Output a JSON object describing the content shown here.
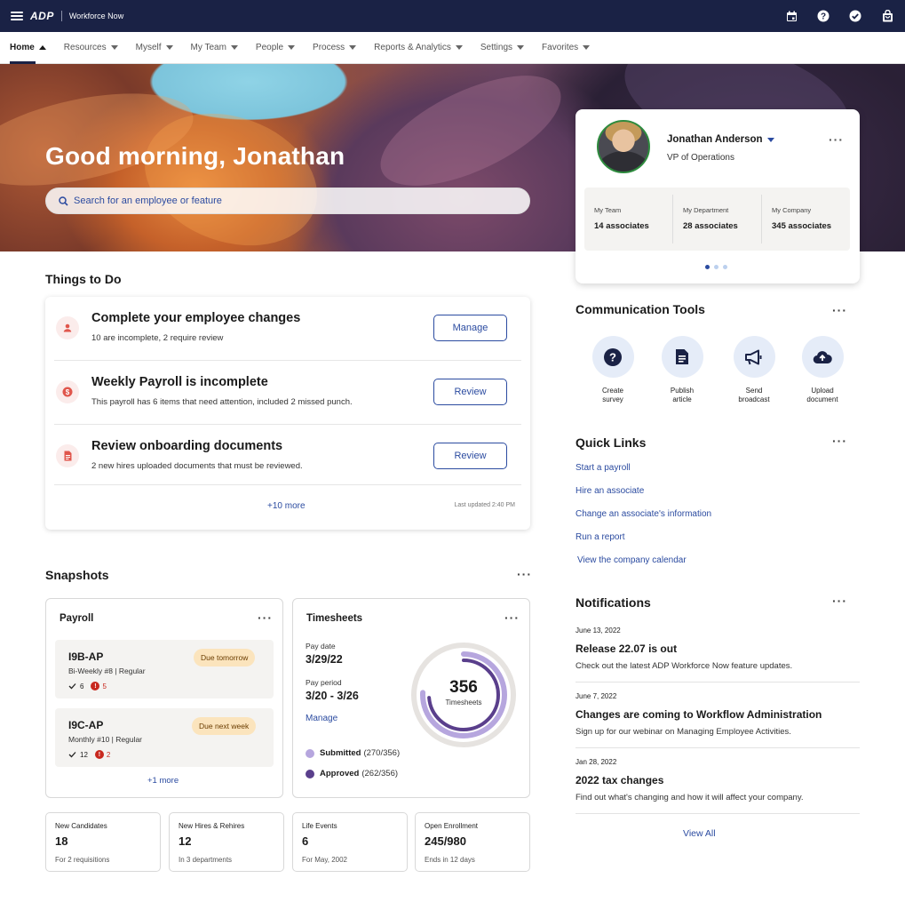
{
  "topbar": {
    "logo": "ADP",
    "app_title": "Workforce Now"
  },
  "nav": {
    "items": [
      {
        "label": "Home"
      },
      {
        "label": "Resources"
      },
      {
        "label": "Myself"
      },
      {
        "label": "My Team"
      },
      {
        "label": "People"
      },
      {
        "label": "Process"
      },
      {
        "label": "Reports & Analytics"
      },
      {
        "label": "Settings"
      },
      {
        "label": "Favorites"
      }
    ],
    "active": "Home"
  },
  "hero": {
    "greeting": "Good morning,  Jonathan",
    "search_placeholder": "Search for an employee or feature"
  },
  "profile": {
    "name": "Jonathan Anderson",
    "role": "VP of Operations",
    "stats": [
      {
        "label": "My Team",
        "value": "14 associates"
      },
      {
        "label": "My Department",
        "value": "28 associates"
      },
      {
        "label": "My Company",
        "value": "345 associates"
      }
    ],
    "carousel_page": 1,
    "carousel_pages": 3
  },
  "things_to_do": {
    "title": "Things to Do",
    "items": [
      {
        "icon": "person-icon",
        "title": "Complete your employee changes",
        "subtitle": "10 are incomplete, 2 require review",
        "button": "Manage"
      },
      {
        "icon": "dollar-icon",
        "title": "Weekly Payroll is incomplete",
        "subtitle": "This payroll has 6 items that need attention, included 2 missed punch.",
        "button": "Review"
      },
      {
        "icon": "document-icon",
        "title": "Review onboarding documents",
        "subtitle": "2 new hires uploaded documents that must be reviewed.",
        "button": "Review"
      }
    ],
    "more_link": "+10 more",
    "last_updated": "Last updated 2:40 PM"
  },
  "snapshots": {
    "title": "Snapshots",
    "payroll": {
      "title": "Payroll",
      "items": [
        {
          "code": "I9B-AP",
          "sub": "Bi-Weekly #8 |  Regular",
          "badge": "Due tomorrow",
          "ok": "6",
          "errors": "5"
        },
        {
          "code": "I9C-AP",
          "sub": "Monthly #10 |  Regular",
          "badge": "Due next week",
          "ok": "12",
          "errors": "2"
        }
      ],
      "more_link": "+1 more"
    },
    "timesheets": {
      "title": "Timesheets",
      "pay_date_label": "Pay date",
      "pay_date": "3/29/22",
      "pay_period_label": "Pay period",
      "pay_period": "3/20 - 3/26",
      "manage_link": "Manage",
      "total": "356",
      "total_label": "Timesheets",
      "submitted_label": "Submitted",
      "submitted_value": "(270/356)",
      "approved_label": "Approved",
      "approved_value": "(262/356)",
      "submitted_fraction": 0.758,
      "approved_fraction": 0.736,
      "colors": {
        "submitted": "#b6a6de",
        "approved": "#5a3f8c",
        "track": "#e6e3e0"
      }
    },
    "tiles": [
      {
        "label": "New Candidates",
        "value": "18",
        "sub": "For 2 requisitions"
      },
      {
        "label": "New Hires & Rehires",
        "value": "12",
        "sub": "In 3 departments"
      },
      {
        "label": "Life Events",
        "value": "6",
        "sub": "For May, 2002"
      },
      {
        "label": "Open Enrollment",
        "value": "245/980",
        "sub": "Ends in 12 days"
      }
    ]
  },
  "communication_tools": {
    "title": "Communication Tools",
    "tools": [
      {
        "icon": "question-icon",
        "label_line1": "Create",
        "label_line2": "survey"
      },
      {
        "icon": "article-icon",
        "label_line1": "Publish",
        "label_line2": "article"
      },
      {
        "icon": "megaphone-icon",
        "label_line1": "Send",
        "label_line2": "broadcast"
      },
      {
        "icon": "cloud-upload-icon",
        "label_line1": "Upload",
        "label_line2": "document"
      }
    ]
  },
  "quick_links": {
    "title": "Quick Links",
    "links": [
      "Start a payroll",
      "Hire an associate",
      "Change an associate's information",
      "Run a report",
      "View the company calendar"
    ]
  },
  "notifications": {
    "title": "Notifications",
    "items": [
      {
        "date": "June 13, 2022",
        "title": "Release 22.07 is out",
        "text": "Check out the latest ADP Workforce Now feature updates."
      },
      {
        "date": "June 7, 2022",
        "title": "Changes are coming to Workflow Administration",
        "text": "Sign up for our webinar on Managing Employee Activities."
      },
      {
        "date": "Jan 28, 2022",
        "title": "2022 tax changes",
        "text": "Find out what's changing and how it will affect your company."
      }
    ],
    "view_all": "View All"
  },
  "colors": {
    "navy": "#1a2245",
    "link": "#2b4ba0",
    "error": "#c8281e",
    "badge": "#fbe4bd"
  }
}
